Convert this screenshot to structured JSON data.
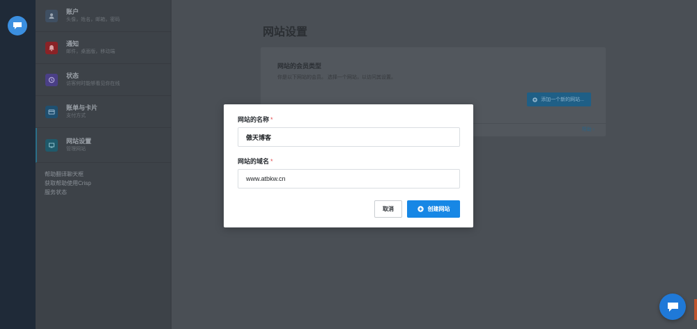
{
  "sidebar": {
    "items": [
      {
        "title": "账户",
        "subtitle": "头像，姓名，邮箱，密码",
        "icon": "user-icon",
        "color": "#3f4f62"
      },
      {
        "title": "通知",
        "subtitle": "邮件，桌面版，移动端",
        "icon": "bell-icon",
        "color": "#8a2226"
      },
      {
        "title": "状态",
        "subtitle": "访客何时能够看见你在线",
        "icon": "clock-icon",
        "color": "#4a3f86"
      },
      {
        "title": "账单与卡片",
        "subtitle": "支付方式",
        "icon": "card-icon",
        "color": "#1f4f6f"
      },
      {
        "title": "网站设置",
        "subtitle": "管理网站",
        "icon": "monitor-icon",
        "color": "#1f5a6b"
      }
    ],
    "links": [
      "帮助翻译聊天框",
      "获取帮助使用Crisp",
      "服务状态"
    ]
  },
  "main": {
    "title": "网站设置",
    "card": {
      "title": "网站的会员类型",
      "description": "你是以下网站的会员。 选择一个网站，以访问其设置。",
      "add_button": "添加一个新的网站...",
      "help_link": "帮助 ›"
    }
  },
  "modal": {
    "name_label": "网站的名称",
    "name_value": "傲天博客",
    "domain_label": "网站的域名",
    "domain_value": "www.atbkw.cn",
    "required_mark": "*",
    "cancel_label": "取消",
    "create_label": "创建网站"
  },
  "colors": {
    "accent": "#1787e5",
    "rail": "#1f2a38"
  }
}
